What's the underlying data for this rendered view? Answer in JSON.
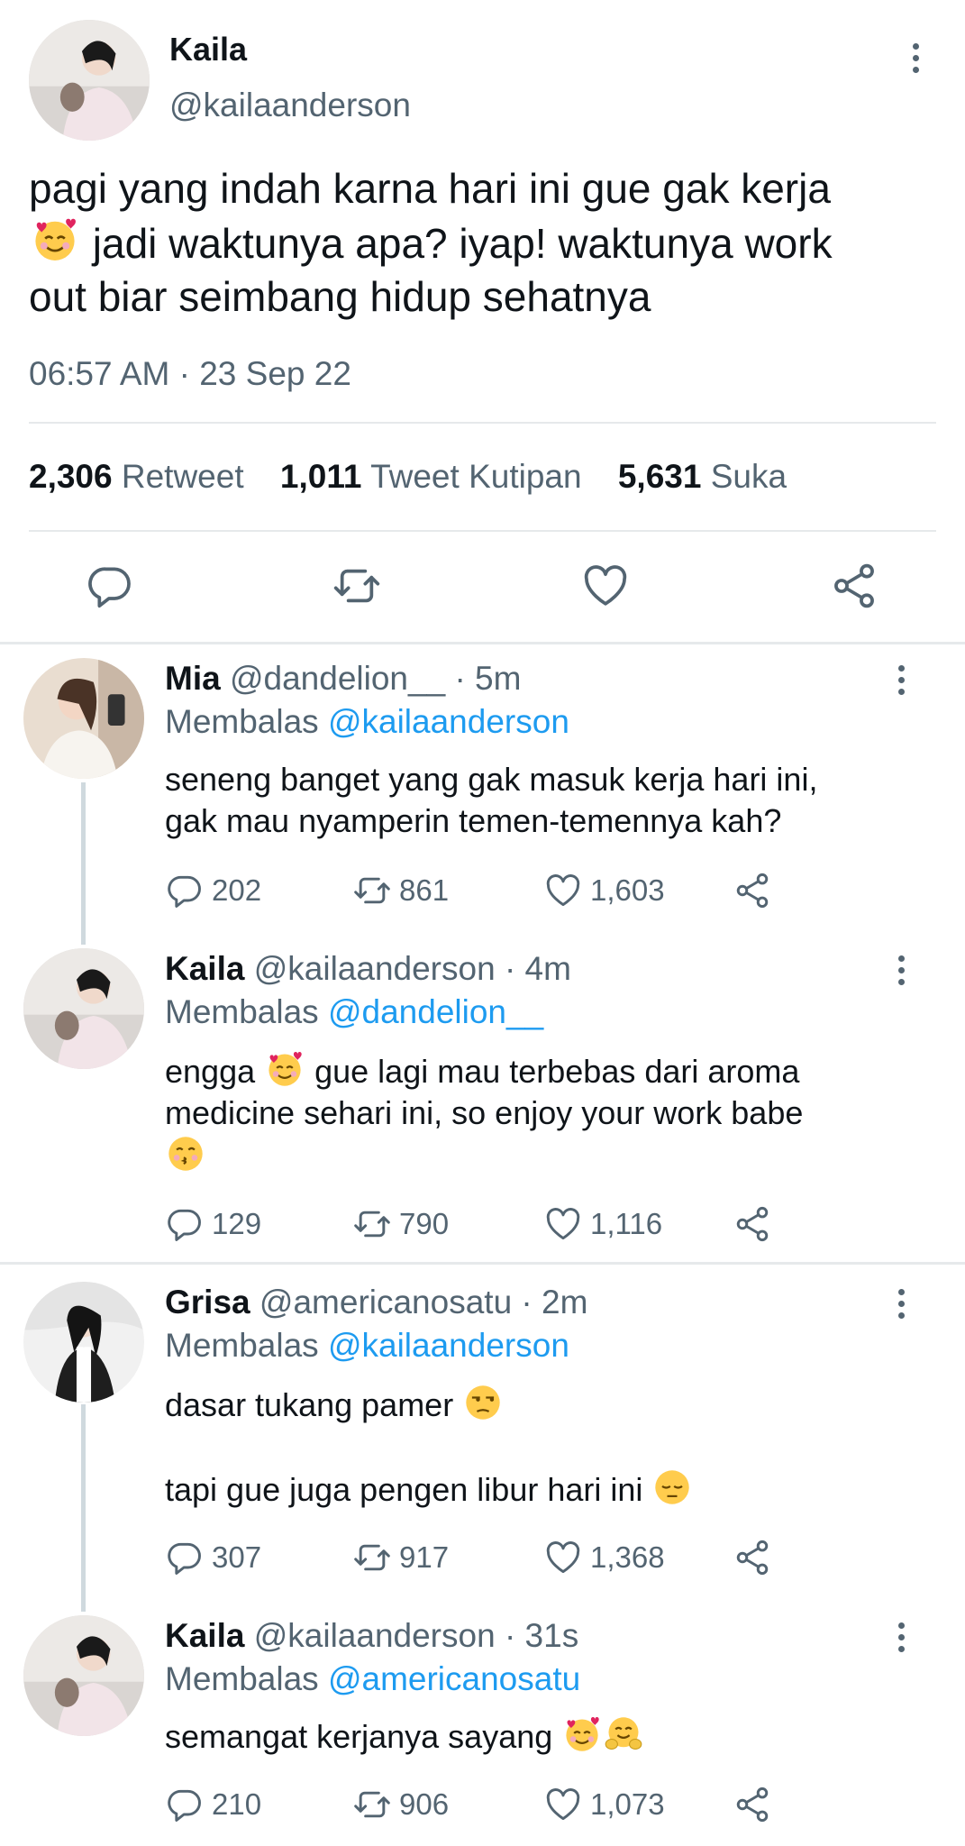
{
  "tweet": {
    "name": "Kaila",
    "handle": "@kailaanderson",
    "text_line1": "pagi yang indah karna hari ini gue gak kerja",
    "text_line2": " jadi waktunya apa? iyap! waktunya work",
    "text_line3": "out biar seimbang hidup sehatnya",
    "timestamp": "06:57 AM · 23 Sep 22",
    "stats": {
      "retweets": "2,306",
      "retweets_label": "Retweet",
      "quotes": "1,011",
      "quotes_label": "Tweet Kutipan",
      "likes": "5,631",
      "likes_label": "Suka"
    }
  },
  "replies": [
    {
      "name": "Mia",
      "meta": " @dandelion__ · 5m",
      "reply_prefix": "Membalas ",
      "reply_to": "@kailaanderson",
      "text1": "seneng banget yang gak masuk kerja hari ini,",
      "text2": "gak mau nyamperin temen-temennya kah?",
      "comments": "202",
      "retweets": "861",
      "likes": "1,603"
    },
    {
      "name": "Kaila",
      "meta": " @kailaanderson · 4m",
      "reply_prefix": "Membalas ",
      "reply_to": "@dandelion__",
      "text1a": "engga ",
      "text1b": " gue lagi mau terbebas dari aroma",
      "text2": "medicine sehari ini, so enjoy your work babe",
      "comments": "129",
      "retweets": "790",
      "likes": "1,116"
    },
    {
      "name": "Grisa",
      "meta": " @americanosatu · 2m",
      "reply_prefix": "Membalas ",
      "reply_to": "@kailaanderson",
      "text1": "dasar tukang pamer ",
      "text2": "tapi gue juga pengen libur hari ini ",
      "comments": "307",
      "retweets": "917",
      "likes": "1,368"
    },
    {
      "name": "Kaila",
      "meta": " @kailaanderson · 31s",
      "reply_prefix": "Membalas ",
      "reply_to": "@americanosatu",
      "text1": "semangat kerjanya sayang ",
      "comments": "210",
      "retweets": "906",
      "likes": "1,073"
    }
  ],
  "icons": {
    "reply": "comment-icon",
    "retweet": "retweet-icon",
    "like": "heart-icon",
    "share": "share-icon",
    "more": "more-vertical-icon",
    "emoji_hearts": "smiling-face-with-hearts-emoji",
    "emoji_kiss": "kissing-face-emoji",
    "emoji_unamused": "unamused-face-emoji",
    "emoji_pensive": "pensive-face-emoji",
    "emoji_hug": "hugging-face-emoji"
  },
  "colors": {
    "accent": "#1d9bf0",
    "muted": "#536471",
    "text": "#0f1419",
    "divider": "#e6e9eb"
  }
}
